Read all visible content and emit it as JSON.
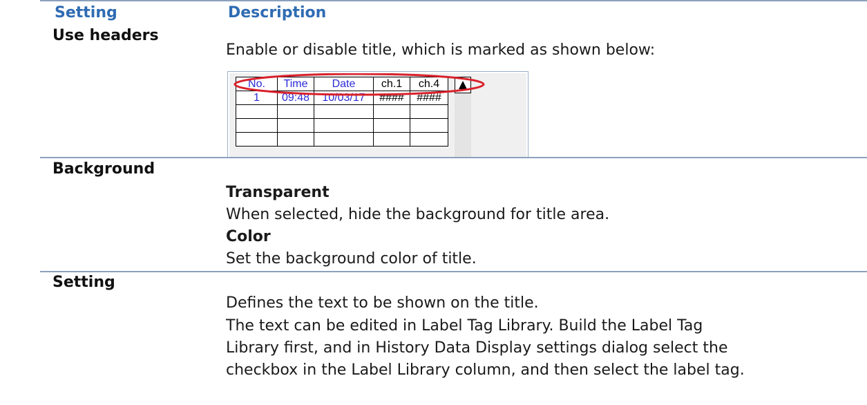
{
  "table": {
    "headers": [
      "Setting",
      "Description"
    ],
    "rows": [
      {
        "name": "Use headers",
        "lines": [
          "Enable or disable title, which is marked as shown below:"
        ]
      },
      {
        "name": "Background",
        "lines": [
          {
            "text": "Transparent",
            "bold": true
          },
          {
            "text": "When selected, hide the background for title area.",
            "bold": false
          },
          {
            "text": "Color",
            "bold": true
          },
          {
            "text": "Set the background color of title.",
            "bold": false
          }
        ]
      },
      {
        "name": "Setting",
        "lines": [
          "Defines the text to be shown on the title.",
          "The text can be edited in Label Tag Library. Build the Label Tag",
          "Library first, and in History Data Display settings dialog select the",
          "checkbox in the Label Library column, and then select the label tag."
        ]
      }
    ]
  },
  "example": {
    "headers": [
      "No.",
      "Time",
      "Date",
      "ch.1",
      "ch.4"
    ],
    "row1": [
      "1",
      "09:48",
      "10/03/17",
      "####",
      "####"
    ],
    "highlight_color": "#d9202a",
    "scroll_icon": "triangle-up-icon"
  },
  "colors": {
    "header_text": "#2f6cb3",
    "rule": "#8aa0bd"
  }
}
